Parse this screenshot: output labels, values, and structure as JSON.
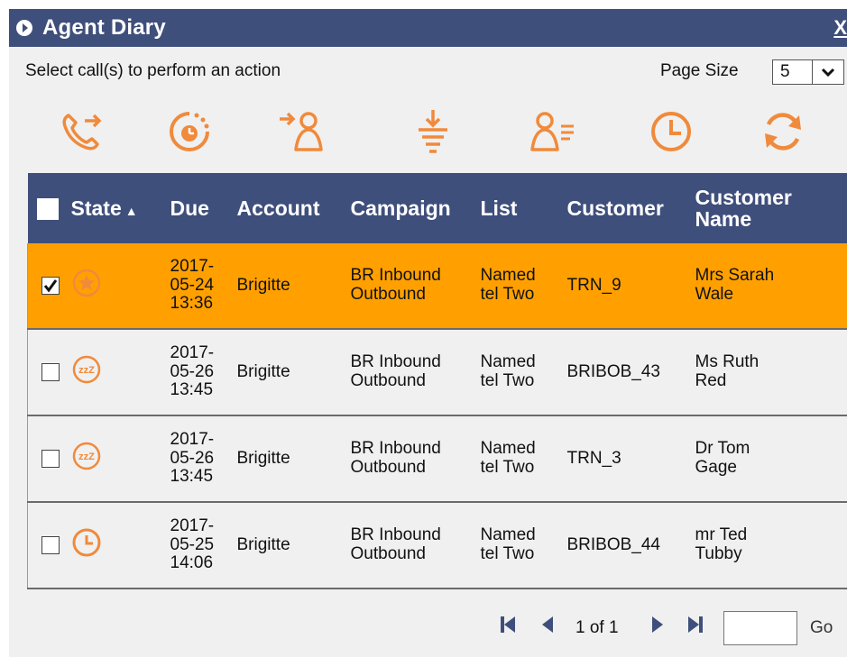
{
  "window": {
    "title": "Agent Diary",
    "close_label": "X"
  },
  "toolbar": {
    "instruction": "Select call(s) to perform an action",
    "page_size_label": "Page Size",
    "page_size_value": "5"
  },
  "actions": [
    {
      "icon": "call-transfer-icon"
    },
    {
      "icon": "reschedule-icon"
    },
    {
      "icon": "assign-to-agent-icon"
    },
    {
      "icon": "move-down-icon"
    },
    {
      "icon": "agent-list-icon"
    },
    {
      "icon": "clock-icon"
    },
    {
      "icon": "refresh-icon"
    }
  ],
  "columns": {
    "state": "State",
    "sort_indicator": "▲",
    "due": "Due",
    "account": "Account",
    "campaign": "Campaign",
    "list": "List",
    "customer": "Customer",
    "customer_name_1": "Customer",
    "customer_name_2": "Name"
  },
  "rows": [
    {
      "selected": true,
      "state_icon": "star-icon",
      "due_1": "2017-",
      "due_2": "05-24",
      "due_3": "13:36",
      "account": "Brigitte",
      "campaign_1": "BR Inbound",
      "campaign_2": "Outbound",
      "list_1": "Named",
      "list_2": "tel Two",
      "customer": "TRN_9",
      "name_1": "Mrs Sarah",
      "name_2": "Wale"
    },
    {
      "selected": false,
      "state_icon": "sleep-icon",
      "due_1": "2017-",
      "due_2": "05-26",
      "due_3": "13:45",
      "account": "Brigitte",
      "campaign_1": "BR Inbound",
      "campaign_2": "Outbound",
      "list_1": "Named",
      "list_2": "tel Two",
      "customer": "BRIBOB_43",
      "name_1": "Ms Ruth",
      "name_2": "Red"
    },
    {
      "selected": false,
      "state_icon": "sleep-icon",
      "due_1": "2017-",
      "due_2": "05-26",
      "due_3": "13:45",
      "account": "Brigitte",
      "campaign_1": "BR Inbound",
      "campaign_2": "Outbound",
      "list_1": "Named",
      "list_2": "tel Two",
      "customer": "TRN_3",
      "name_1": "Dr Tom",
      "name_2": "Gage"
    },
    {
      "selected": false,
      "state_icon": "clock-icon",
      "due_1": "2017-",
      "due_2": "05-25",
      "due_3": "14:06",
      "account": "Brigitte",
      "campaign_1": "BR Inbound",
      "campaign_2": "Outbound",
      "list_1": "Named",
      "list_2": "tel Two",
      "customer": "BRIBOB_44",
      "name_1": "mr Ted",
      "name_2": "Tubby"
    }
  ],
  "pager": {
    "page_text": "1 of 1",
    "go_label": "Go",
    "page_input_value": ""
  },
  "colors": {
    "header_bg": "#3f4f7c",
    "accent_orange": "#f08a3c",
    "selected_row": "#ffa000",
    "panel_bg": "#f0f0f0"
  }
}
